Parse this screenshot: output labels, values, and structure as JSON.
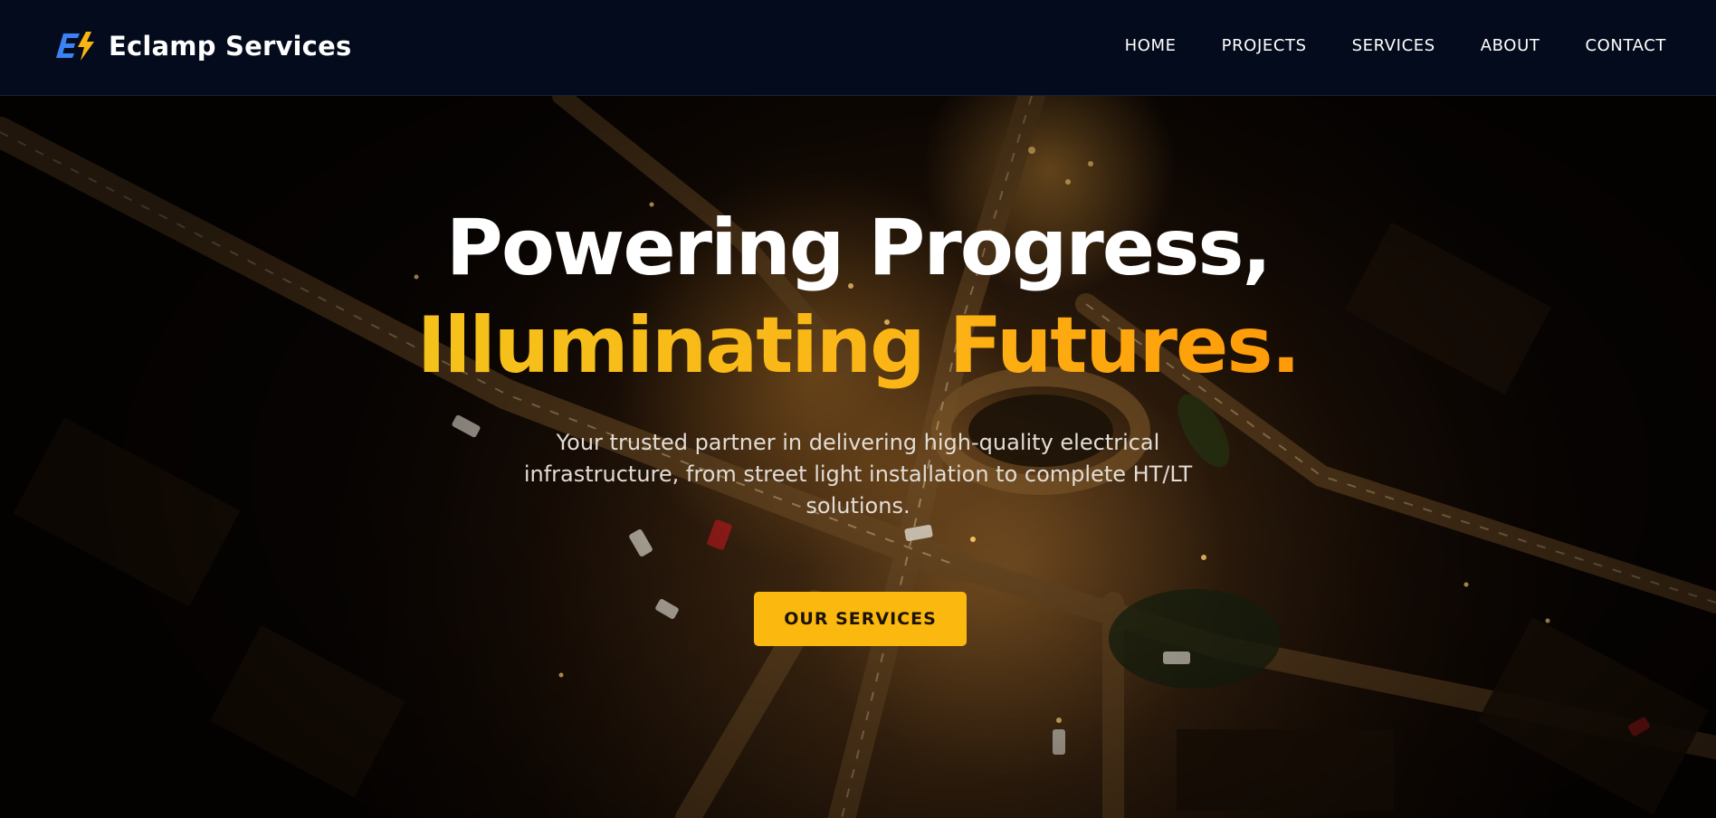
{
  "brand": {
    "name": "Eclamp Services",
    "logo_icon": "bolt-e-logo-icon"
  },
  "nav": {
    "items": [
      {
        "label": "HOME"
      },
      {
        "label": "PROJECTS"
      },
      {
        "label": "SERVICES"
      },
      {
        "label": "ABOUT"
      },
      {
        "label": "CONTACT"
      }
    ]
  },
  "hero": {
    "headline_line1": "Powering Progress,",
    "headline_line2": "Illuminating Futures.",
    "subtitle": "Your trusted partner in delivering high-quality electrical infrastructure, from street light installation to complete HT/LT solutions.",
    "cta_label": "OUR SERVICES",
    "background": "night-aerial-city-roundabout-image"
  },
  "colors": {
    "nav_background": "#040b1c",
    "accent_yellow": "#fbb80f",
    "accent_orange": "#ff9a08",
    "logo_blue": "#3b82f6"
  }
}
